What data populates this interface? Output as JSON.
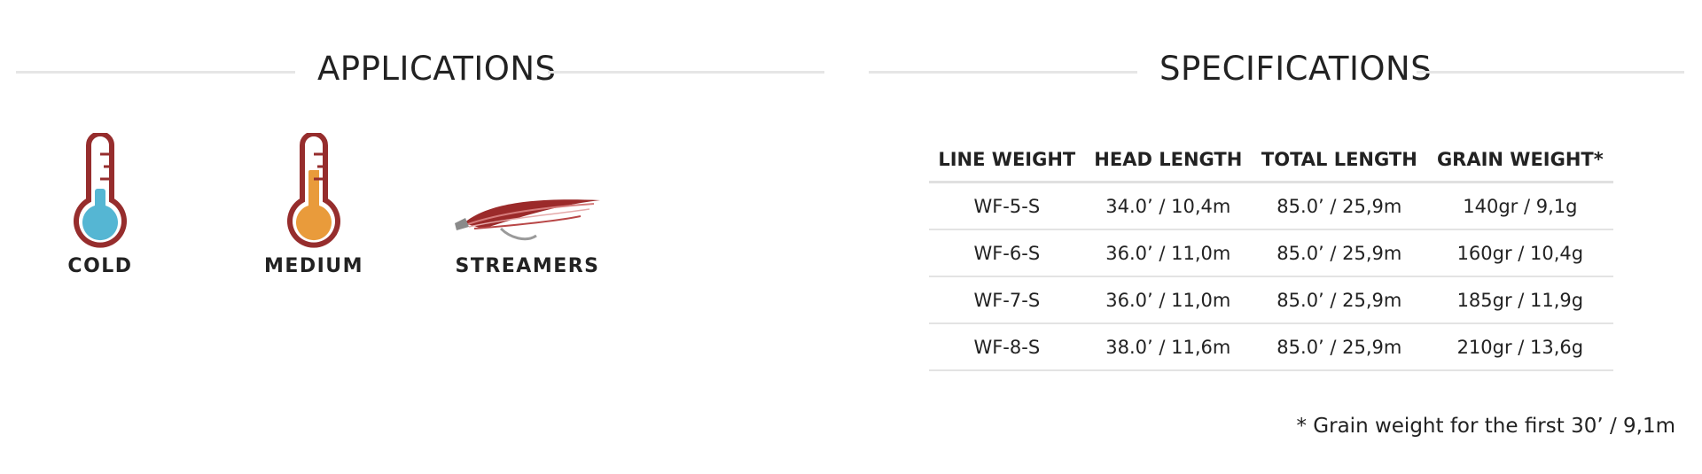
{
  "applications": {
    "title": "APPLICATIONS",
    "items": [
      {
        "label": "COLD",
        "icon": "thermometer-cold-icon",
        "color": "#55b6d3"
      },
      {
        "label": "MEDIUM",
        "icon": "thermometer-medium-icon",
        "color": "#e99b3b"
      },
      {
        "label": "STREAMERS",
        "icon": "streamer-fly-icon",
        "color": "#9b2a2a"
      }
    ]
  },
  "specifications": {
    "title": "SPECIFICATIONS",
    "headers": [
      "LINE WEIGHT",
      "HEAD LENGTH",
      "TOTAL LENGTH",
      "GRAIN WEIGHT*"
    ],
    "rows": [
      [
        "WF-5-S",
        "34.0’ / 10,4m",
        "85.0’ / 25,9m",
        "140gr / 9,1g"
      ],
      [
        "WF-6-S",
        "36.0’ / 11,0m",
        "85.0’ / 25,9m",
        "160gr / 10,4g"
      ],
      [
        "WF-7-S",
        "36.0’ / 11,0m",
        "85.0’ / 25,9m",
        "185gr / 11,9g"
      ],
      [
        "WF-8-S",
        "38.0’ / 11,6m",
        "85.0’ / 25,9m",
        "210gr / 13,6g"
      ]
    ],
    "footnote": "* Grain weight for the first 30’ / 9,1m"
  },
  "colors": {
    "thermometer_outline": "#962d2d",
    "rule": "#e6e6e6"
  }
}
